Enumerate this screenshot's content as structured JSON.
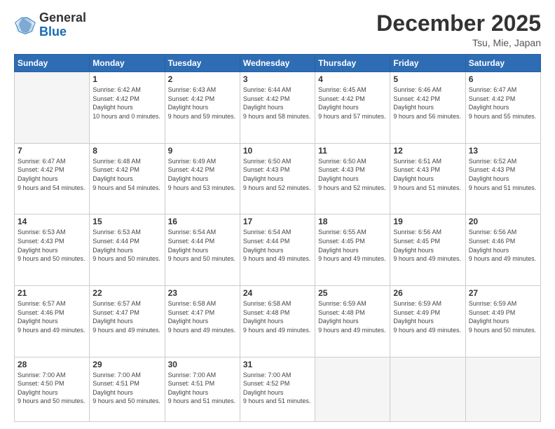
{
  "header": {
    "logo_general": "General",
    "logo_blue": "Blue",
    "month": "December 2025",
    "location": "Tsu, Mie, Japan"
  },
  "days_of_week": [
    "Sunday",
    "Monday",
    "Tuesday",
    "Wednesday",
    "Thursday",
    "Friday",
    "Saturday"
  ],
  "weeks": [
    [
      {
        "day": "",
        "sunrise": "",
        "sunset": "",
        "daylight": "",
        "empty": true
      },
      {
        "day": "1",
        "sunrise": "6:42 AM",
        "sunset": "4:42 PM",
        "daylight": "10 hours and 0 minutes."
      },
      {
        "day": "2",
        "sunrise": "6:43 AM",
        "sunset": "4:42 PM",
        "daylight": "9 hours and 59 minutes."
      },
      {
        "day": "3",
        "sunrise": "6:44 AM",
        "sunset": "4:42 PM",
        "daylight": "9 hours and 58 minutes."
      },
      {
        "day": "4",
        "sunrise": "6:45 AM",
        "sunset": "4:42 PM",
        "daylight": "9 hours and 57 minutes."
      },
      {
        "day": "5",
        "sunrise": "6:46 AM",
        "sunset": "4:42 PM",
        "daylight": "9 hours and 56 minutes."
      },
      {
        "day": "6",
        "sunrise": "6:47 AM",
        "sunset": "4:42 PM",
        "daylight": "9 hours and 55 minutes."
      }
    ],
    [
      {
        "day": "7",
        "sunrise": "6:47 AM",
        "sunset": "4:42 PM",
        "daylight": "9 hours and 54 minutes."
      },
      {
        "day": "8",
        "sunrise": "6:48 AM",
        "sunset": "4:42 PM",
        "daylight": "9 hours and 54 minutes."
      },
      {
        "day": "9",
        "sunrise": "6:49 AM",
        "sunset": "4:42 PM",
        "daylight": "9 hours and 53 minutes."
      },
      {
        "day": "10",
        "sunrise": "6:50 AM",
        "sunset": "4:43 PM",
        "daylight": "9 hours and 52 minutes."
      },
      {
        "day": "11",
        "sunrise": "6:50 AM",
        "sunset": "4:43 PM",
        "daylight": "9 hours and 52 minutes."
      },
      {
        "day": "12",
        "sunrise": "6:51 AM",
        "sunset": "4:43 PM",
        "daylight": "9 hours and 51 minutes."
      },
      {
        "day": "13",
        "sunrise": "6:52 AM",
        "sunset": "4:43 PM",
        "daylight": "9 hours and 51 minutes."
      }
    ],
    [
      {
        "day": "14",
        "sunrise": "6:53 AM",
        "sunset": "4:43 PM",
        "daylight": "9 hours and 50 minutes."
      },
      {
        "day": "15",
        "sunrise": "6:53 AM",
        "sunset": "4:44 PM",
        "daylight": "9 hours and 50 minutes."
      },
      {
        "day": "16",
        "sunrise": "6:54 AM",
        "sunset": "4:44 PM",
        "daylight": "9 hours and 50 minutes."
      },
      {
        "day": "17",
        "sunrise": "6:54 AM",
        "sunset": "4:44 PM",
        "daylight": "9 hours and 49 minutes."
      },
      {
        "day": "18",
        "sunrise": "6:55 AM",
        "sunset": "4:45 PM",
        "daylight": "9 hours and 49 minutes."
      },
      {
        "day": "19",
        "sunrise": "6:56 AM",
        "sunset": "4:45 PM",
        "daylight": "9 hours and 49 minutes."
      },
      {
        "day": "20",
        "sunrise": "6:56 AM",
        "sunset": "4:46 PM",
        "daylight": "9 hours and 49 minutes."
      }
    ],
    [
      {
        "day": "21",
        "sunrise": "6:57 AM",
        "sunset": "4:46 PM",
        "daylight": "9 hours and 49 minutes."
      },
      {
        "day": "22",
        "sunrise": "6:57 AM",
        "sunset": "4:47 PM",
        "daylight": "9 hours and 49 minutes."
      },
      {
        "day": "23",
        "sunrise": "6:58 AM",
        "sunset": "4:47 PM",
        "daylight": "9 hours and 49 minutes."
      },
      {
        "day": "24",
        "sunrise": "6:58 AM",
        "sunset": "4:48 PM",
        "daylight": "9 hours and 49 minutes."
      },
      {
        "day": "25",
        "sunrise": "6:59 AM",
        "sunset": "4:48 PM",
        "daylight": "9 hours and 49 minutes."
      },
      {
        "day": "26",
        "sunrise": "6:59 AM",
        "sunset": "4:49 PM",
        "daylight": "9 hours and 49 minutes."
      },
      {
        "day": "27",
        "sunrise": "6:59 AM",
        "sunset": "4:49 PM",
        "daylight": "9 hours and 50 minutes."
      }
    ],
    [
      {
        "day": "28",
        "sunrise": "7:00 AM",
        "sunset": "4:50 PM",
        "daylight": "9 hours and 50 minutes."
      },
      {
        "day": "29",
        "sunrise": "7:00 AM",
        "sunset": "4:51 PM",
        "daylight": "9 hours and 50 minutes."
      },
      {
        "day": "30",
        "sunrise": "7:00 AM",
        "sunset": "4:51 PM",
        "daylight": "9 hours and 51 minutes."
      },
      {
        "day": "31",
        "sunrise": "7:00 AM",
        "sunset": "4:52 PM",
        "daylight": "9 hours and 51 minutes."
      },
      {
        "day": "",
        "sunrise": "",
        "sunset": "",
        "daylight": "",
        "empty": true
      },
      {
        "day": "",
        "sunrise": "",
        "sunset": "",
        "daylight": "",
        "empty": true
      },
      {
        "day": "",
        "sunrise": "",
        "sunset": "",
        "daylight": "",
        "empty": true
      }
    ]
  ],
  "labels": {
    "sunrise_prefix": "Sunrise: ",
    "sunset_prefix": "Sunset: ",
    "daylight_prefix": "Daylight hours"
  }
}
